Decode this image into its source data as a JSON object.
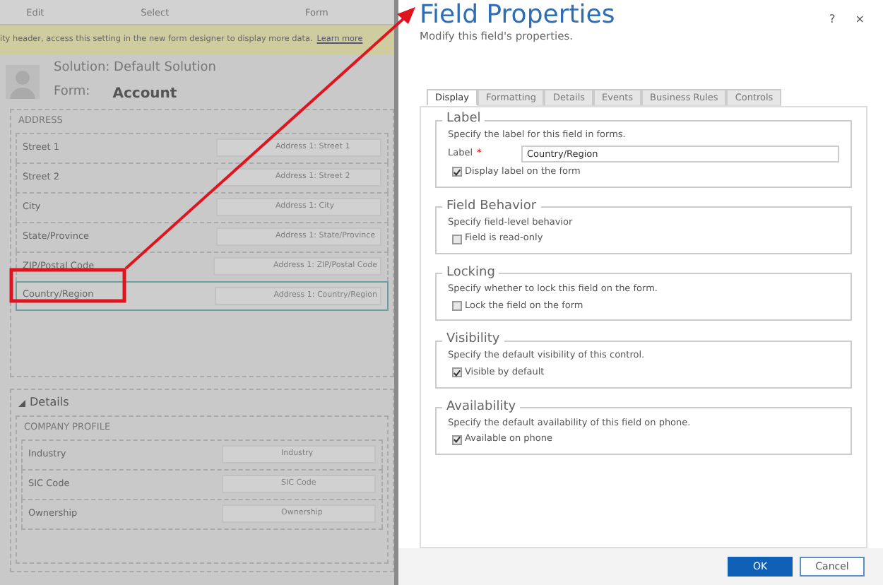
{
  "background_form": {
    "ribbon_groups": [
      "Edit",
      "Select",
      "Form"
    ],
    "notice": {
      "text": "ity header, access this setting in the new form designer to display more data.",
      "link": "Learn more"
    },
    "solution": "Solution: Default Solution",
    "form_label": "Form:",
    "form_name": "Account",
    "address_section": {
      "title": "ADDRESS",
      "fields": [
        {
          "label": "Street 1",
          "placeholder": "Address 1: Street 1",
          "selected": false
        },
        {
          "label": "Street 2",
          "placeholder": "Address 1: Street 2",
          "selected": false
        },
        {
          "label": "City",
          "placeholder": "Address 1: City",
          "selected": false
        },
        {
          "label": "State/Province",
          "placeholder": "Address 1: State/Province",
          "selected": false
        },
        {
          "label": "ZIP/Postal Code",
          "placeholder": "Address 1: ZIP/Postal Code",
          "selected": false
        },
        {
          "label": "Country/Region",
          "placeholder": "Address 1: Country/Region",
          "selected": true
        }
      ]
    },
    "details_tab": {
      "expanded": true,
      "title": "Details",
      "section": "COMPANY PROFILE",
      "fields": [
        {
          "label": "Industry",
          "placeholder": "Industry",
          "selected": false
        },
        {
          "label": "SIC Code",
          "placeholder": "SIC Code",
          "selected": false
        },
        {
          "label": "Ownership",
          "placeholder": "Ownership",
          "selected": false
        }
      ]
    }
  },
  "dialog": {
    "title": "Field Properties",
    "subtitle": "Modify this field's properties.",
    "help": "?",
    "close": "×",
    "tabs": [
      {
        "label": "Display",
        "selected": true
      },
      {
        "label": "Formatting",
        "selected": false
      },
      {
        "label": "Details",
        "selected": false
      },
      {
        "label": "Events",
        "selected": false
      },
      {
        "label": "Business Rules",
        "selected": false
      },
      {
        "label": "Controls",
        "selected": false
      }
    ],
    "groups": [
      {
        "legend": "Label",
        "description": "Specify the label for this field in forms.",
        "field": {
          "label": "Label",
          "required_mark": "*",
          "value": "Country/Region"
        },
        "checkbox": {
          "label": "Display label on the form",
          "checked": true
        }
      },
      {
        "legend": "Field Behavior",
        "description": "Specify field-level behavior",
        "checkbox": {
          "label": "Field is read-only",
          "checked": false
        }
      },
      {
        "legend": "Locking",
        "description": "Specify whether to lock this field on the form.",
        "checkbox": {
          "label": "Lock the field on the form",
          "checked": false
        }
      },
      {
        "legend": "Visibility",
        "description": "Specify the default visibility of this control.",
        "checkbox": {
          "label": "Visible by default",
          "checked": true
        }
      },
      {
        "legend": "Availability",
        "description": "Specify the default availability of this field on phone.",
        "checkbox": {
          "label": "Available on phone",
          "checked": true
        }
      }
    ],
    "buttons": [
      {
        "label": "OK",
        "kind": "primary"
      },
      {
        "label": "Cancel",
        "kind": "secondary"
      }
    ]
  }
}
